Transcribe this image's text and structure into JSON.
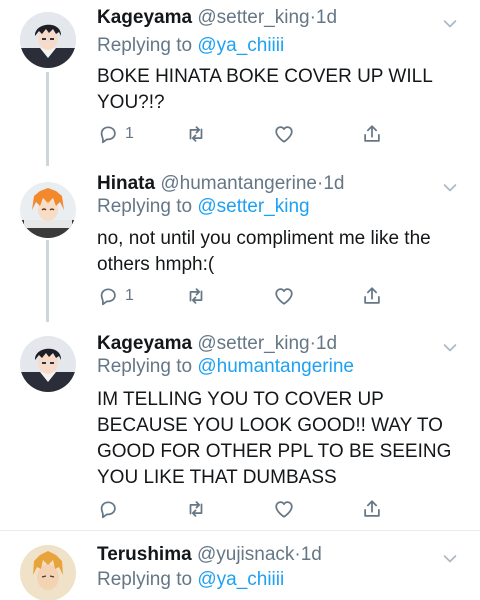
{
  "tweets": [
    {
      "name": "Kageyama",
      "handle": "@setter_king",
      "time": "1d",
      "replying_prefix": "Replying to",
      "replying_to": "@ya_chiiii",
      "text": "BOKE HINATA BOKE COVER UP WILL YOU?!?",
      "reply_count": "1",
      "avatar": "kageyama-avatar"
    },
    {
      "name": "Hinata",
      "handle": "@humantangerine",
      "time": "1d",
      "replying_prefix": "Replying to",
      "replying_to": "@setter_king",
      "text": "no, not until you compliment me like the others hmph:(",
      "reply_count": "1",
      "avatar": "hinata-avatar"
    },
    {
      "name": "Kageyama",
      "handle": "@setter_king",
      "time": "1d",
      "replying_prefix": "Replying to",
      "replying_to": "@humantangerine",
      "text": "IM TELLING YOU TO COVER UP BECAUSE YOU LOOK GOOD!! WAY TO GOOD FOR OTHER PPL TO BE SEEING YOU LIKE THAT DUMBASS",
      "reply_count": "",
      "avatar": "kageyama-avatar"
    },
    {
      "name": "Terushima",
      "handle": "@yujisnack",
      "time": "1d",
      "replying_prefix": "Replying to",
      "replying_to": "@ya_chiiii",
      "text": "",
      "reply_count": "",
      "avatar": "terushima-avatar"
    }
  ],
  "separator": "·",
  "colors": {
    "link": "#1da1f2",
    "muted": "#657786",
    "thread_line": "#ccd6dd",
    "divider": "#e6ecf0"
  },
  "icons": [
    "reply-icon",
    "retweet-icon",
    "like-icon",
    "share-icon",
    "chevron-down-icon"
  ]
}
